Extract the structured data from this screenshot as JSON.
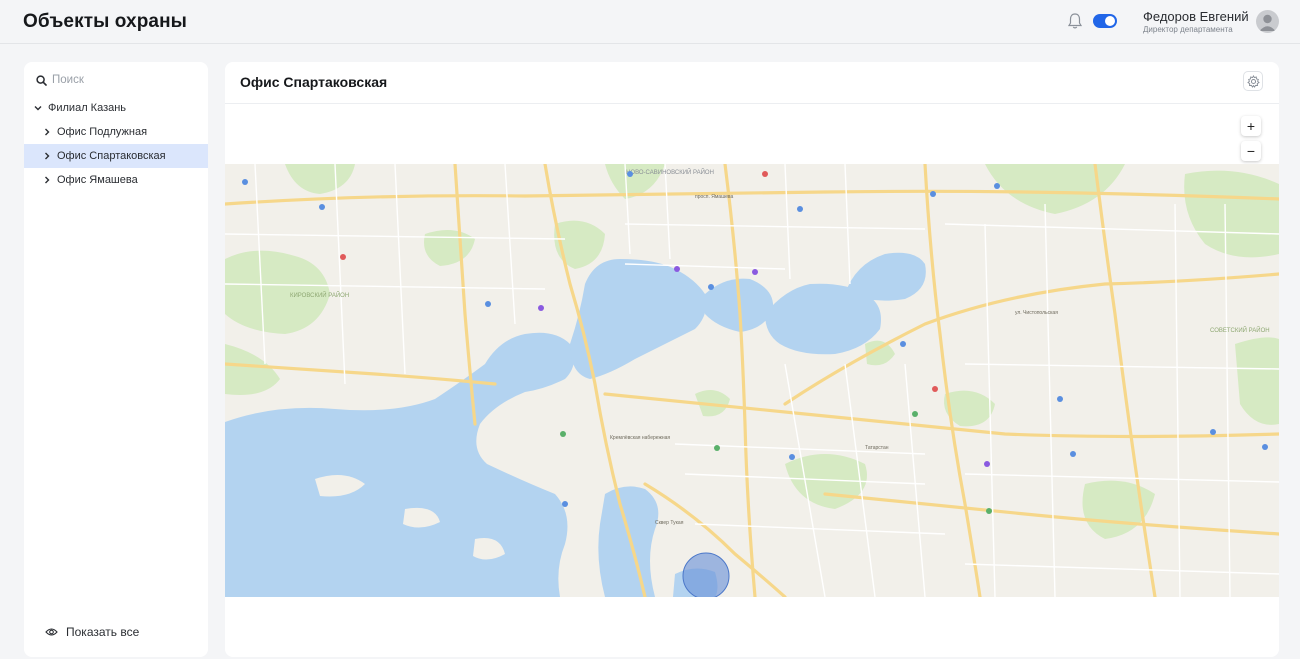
{
  "header": {
    "title": "Объекты охраны",
    "notifications_icon": "bell-icon",
    "toggle_state": "on",
    "user": {
      "name": "Федоров Евгений",
      "role": "Директор департамента"
    },
    "accent_color": "#2166e8"
  },
  "sidebar": {
    "search_placeholder": "Поиск",
    "tree": [
      {
        "label": "Филиал Казань",
        "level": 0,
        "expanded": true,
        "active": false
      },
      {
        "label": "Офис Подлужная",
        "level": 1,
        "expanded": false,
        "active": false
      },
      {
        "label": "Офис Спартаковская",
        "level": 1,
        "expanded": false,
        "active": true
      },
      {
        "label": "Офис Ямашева",
        "level": 1,
        "expanded": false,
        "active": false
      }
    ],
    "show_all_label": "Показать все"
  },
  "panel": {
    "title": "Офис Спартаковская",
    "zoom_in_label": "+",
    "zoom_out_label": "−"
  },
  "map": {
    "labels": [
      "НОВО-САВИНОВСКИЙ РАЙОН",
      "КИРОВСКИЙ РАЙОН",
      "СОВЕТСКИЙ РАЙОН",
      "просп. Ямашева",
      "Кремлёвская набережная",
      "Татарстан",
      "Сквер Тукая",
      "ул. Чистопольская"
    ]
  }
}
